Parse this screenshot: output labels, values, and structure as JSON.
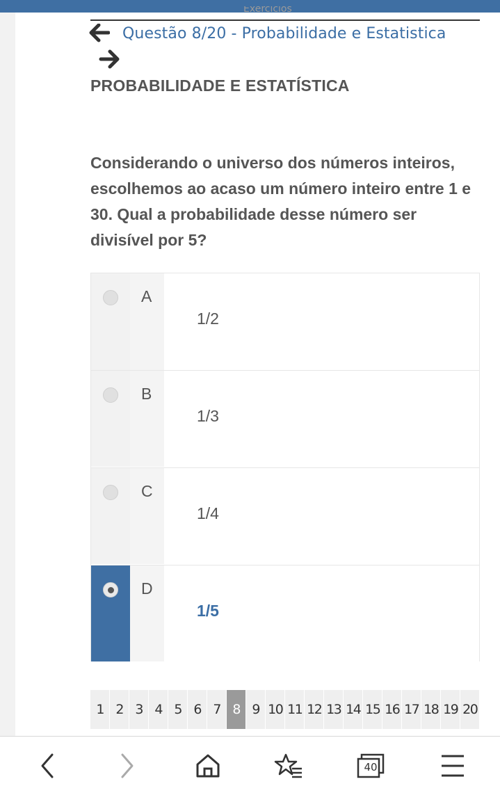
{
  "header": {
    "cut_title": "Exercícios",
    "nav_title": "Questão 8/20 - Probabilidade e Estatistica"
  },
  "subject": "PROBABILIDADE E ESTATÍSTICA",
  "question": "Considerando o universo dos números inteiros, escolhemos ao acaso um número inteiro entre 1 e 30. Qual a probabilidade desse número ser divisível por 5?",
  "options": [
    {
      "letter": "A",
      "text": "1/2",
      "selected": false
    },
    {
      "letter": "B",
      "text": "1/3",
      "selected": false
    },
    {
      "letter": "C",
      "text": "1/4",
      "selected": false
    },
    {
      "letter": "D",
      "text": "1/5",
      "selected": true
    }
  ],
  "pager": {
    "pages": [
      "1",
      "2",
      "3",
      "4",
      "5",
      "6",
      "7",
      "8",
      "9",
      "10",
      "11",
      "12",
      "13",
      "14",
      "15",
      "16",
      "17",
      "18",
      "19",
      "20"
    ],
    "current": "8"
  },
  "browser_nav": {
    "tab_count": "40",
    "icons": [
      "back-icon",
      "forward-icon",
      "home-icon",
      "bookmark-star-icon",
      "tabs-icon",
      "menu-icon"
    ]
  },
  "colors": {
    "accent": "#3f6fa3",
    "link": "#3b6ea5",
    "text": "#555555"
  }
}
